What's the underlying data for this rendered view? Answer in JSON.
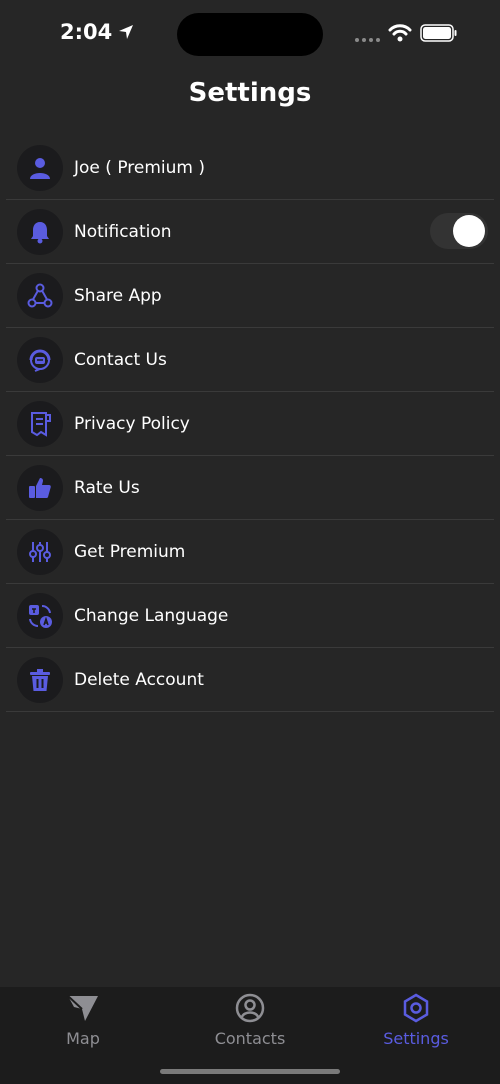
{
  "status_bar": {
    "time": "2:04"
  },
  "header": {
    "title": "Settings"
  },
  "settings": {
    "items": [
      {
        "label": "Joe ( Premium )",
        "icon": "user-icon"
      },
      {
        "label": "Notification",
        "icon": "bell-icon",
        "toggle_on": true
      },
      {
        "label": "Share App",
        "icon": "share-icon"
      },
      {
        "label": "Contact Us",
        "icon": "support-icon"
      },
      {
        "label": "Privacy Policy",
        "icon": "document-icon"
      },
      {
        "label": "Rate Us",
        "icon": "thumbs-up-icon"
      },
      {
        "label": "Get Premium",
        "icon": "sliders-icon"
      },
      {
        "label": "Change Language",
        "icon": "translate-icon"
      },
      {
        "label": "Delete Account",
        "icon": "trash-icon"
      }
    ]
  },
  "tabs": [
    {
      "label": "Map",
      "icon": "map-icon",
      "active": false
    },
    {
      "label": "Contacts",
      "icon": "contacts-icon",
      "active": false
    },
    {
      "label": "Settings",
      "icon": "settings-icon",
      "active": true
    }
  ],
  "colors": {
    "accent": "#5a5ce0",
    "background": "#262626",
    "tab_bar": "#1c1c1c",
    "inactive": "#8e8e93"
  }
}
